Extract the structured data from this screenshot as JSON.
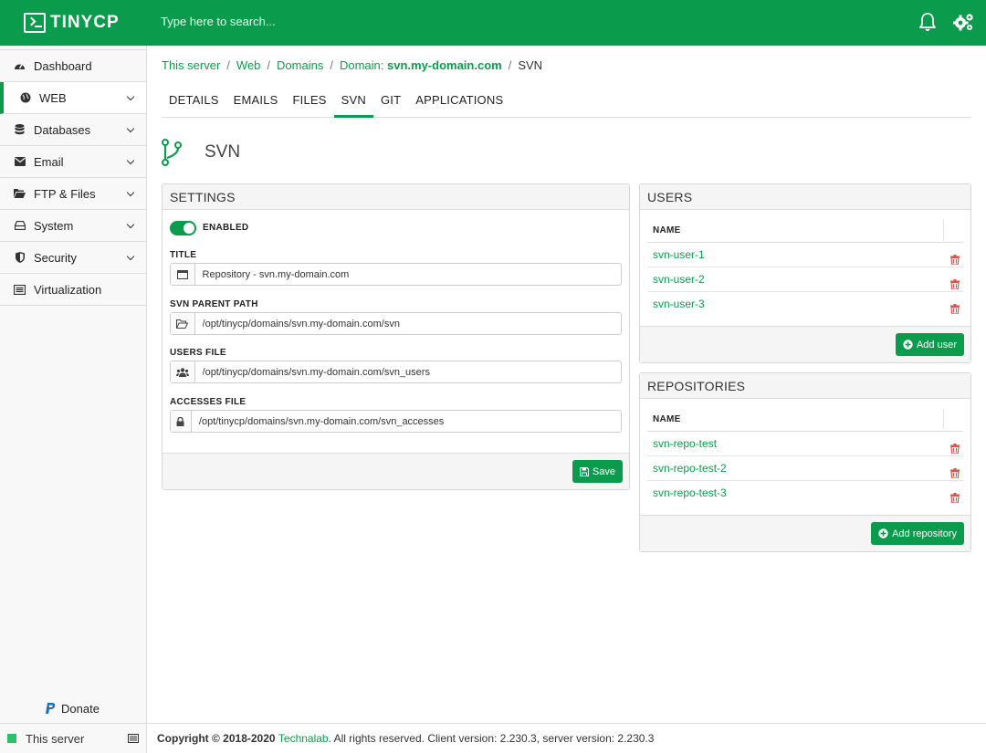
{
  "app": {
    "logo_text": "TINYCP"
  },
  "search": {
    "placeholder": "Type here to search..."
  },
  "sidebar": {
    "items": [
      {
        "label": "Dashboard",
        "icon": "dashboard-icon",
        "has_chevron": false
      },
      {
        "label": "WEB",
        "icon": "globe-icon",
        "has_chevron": true,
        "active": true
      },
      {
        "label": "Databases",
        "icon": "database-icon",
        "has_chevron": true
      },
      {
        "label": "Email",
        "icon": "envelope-icon",
        "has_chevron": true
      },
      {
        "label": "FTP & Files",
        "icon": "folder-icon",
        "has_chevron": true
      },
      {
        "label": "System",
        "icon": "hdd-icon",
        "has_chevron": true
      },
      {
        "label": "Security",
        "icon": "shield-icon",
        "has_chevron": true
      },
      {
        "label": "Virtualization",
        "icon": "server-icon",
        "has_chevron": false
      }
    ],
    "donate_label": "Donate",
    "footer_label": "This server"
  },
  "breadcrumb": {
    "items": [
      "This server",
      "Web",
      "Domains"
    ],
    "domain_prefix": "Domain: ",
    "domain_name": "svn.my-domain.com",
    "current": "SVN"
  },
  "tabs": [
    "DETAILS",
    "EMAILS",
    "FILES",
    "SVN",
    "GIT",
    "APPLICATIONS"
  ],
  "active_tab": "SVN",
  "page_title": "SVN",
  "settings": {
    "title": "SETTINGS",
    "enabled_label": "ENABLED",
    "enabled": true,
    "fields": {
      "title_label": "TITLE",
      "title_value": "Repository - svn.my-domain.com",
      "parent_label": "SVN PARENT PATH",
      "parent_value": "/opt/tinycp/domains/svn.my-domain.com/svn",
      "users_label": "USERS FILE",
      "users_value": "/opt/tinycp/domains/svn.my-domain.com/svn_users",
      "accesses_label": "ACCESSES FILE",
      "accesses_value": "/opt/tinycp/domains/svn.my-domain.com/svn_accesses"
    },
    "save_label": "Save"
  },
  "users": {
    "title": "USERS",
    "column": "NAME",
    "rows": [
      "svn-user-1",
      "svn-user-2",
      "svn-user-3"
    ],
    "add_label": "Add user"
  },
  "repositories": {
    "title": "REPOSITORIES",
    "column": "NAME",
    "rows": [
      "svn-repo-test",
      "svn-repo-test-2",
      "svn-repo-test-3"
    ],
    "add_label": "Add repository"
  },
  "footer": {
    "copyright": "Copyright © 2018-2020 ",
    "company": "Technalab",
    "rest": ". All rights reserved. Client version: 2.230.3, server version: 2.230.3"
  },
  "colors": {
    "brand": "#0a9c4c",
    "danger": "#d9534f"
  }
}
